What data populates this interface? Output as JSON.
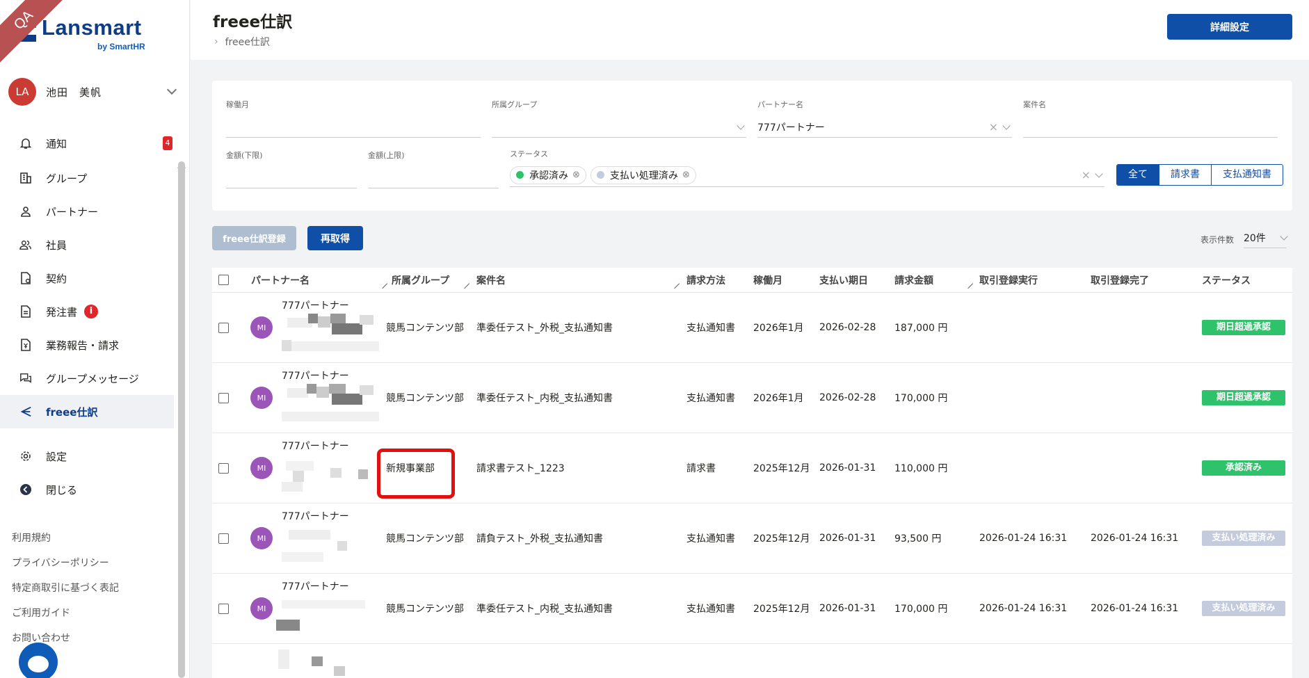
{
  "app": {
    "ribbon": "QA",
    "logo_text": "Lansmart",
    "logo_sub": "by SmartHR"
  },
  "user": {
    "initials": "LA",
    "name": "池田　美帆"
  },
  "nav": {
    "notifications": "通知",
    "notifications_count": "4",
    "group": "グループ",
    "partner": "パートナー",
    "employee": "社員",
    "contract": "契約",
    "order": "発注書",
    "order_badge": "i",
    "report": "業務報告・請求",
    "group_message": "グループメッセージ",
    "freee": "freee仕訳",
    "settings": "設定",
    "close": "閉じる"
  },
  "footer_links": [
    "利用規約",
    "プライバシーポリシー",
    "特定商取引に基づく表記",
    "ご利用ガイド",
    "お問い合わせ"
  ],
  "header": {
    "title": "freee仕訳",
    "breadcrumb": "freee仕訳",
    "detail_button": "詳細設定"
  },
  "filter": {
    "month_label": "稼働月",
    "group_label": "所属グループ",
    "partner_label": "パートナー名",
    "partner_value": "777パートナー",
    "project_label": "案件名",
    "amount_min_label": "金額(下限)",
    "amount_max_label": "金額(上限)",
    "status_label": "ステータス",
    "chips": [
      {
        "label": "承認済み",
        "color": "#2ec36b"
      },
      {
        "label": "支払い処理済み",
        "color": "#c3cbdc"
      }
    ],
    "segments": [
      "全て",
      "請求書",
      "支払通知書"
    ]
  },
  "actions": {
    "register": "freee仕訳登録",
    "refetch": "再取得",
    "page_size_label": "表示件数",
    "page_size_value": "20件"
  },
  "table": {
    "headers": {
      "partner": "パートナー名",
      "group": "所属グループ",
      "project": "案件名",
      "method": "請求方法",
      "month": "稼働月",
      "due": "支払い期日",
      "amount": "請求金額",
      "exec": "取引登録実行",
      "done": "取引登録完了",
      "status": "ステータス"
    },
    "rows": [
      {
        "avatar": "MI",
        "partner": "777パートナー",
        "group": "競馬コンテンツ部",
        "project": "準委任テスト_外税_支払通知書",
        "method": "支払通知書",
        "month": "2026年1月",
        "due": "2026-02-28",
        "amount": "187,000 円",
        "exec": "",
        "done": "",
        "status": "期日超過承認",
        "status_color": "#2ec36b"
      },
      {
        "avatar": "MI",
        "partner": "777パートナー",
        "group": "競馬コンテンツ部",
        "project": "準委任テスト_内税_支払通知書",
        "method": "支払通知書",
        "month": "2026年1月",
        "due": "2026-02-28",
        "amount": "170,000 円",
        "exec": "",
        "done": "",
        "status": "期日超過承認",
        "status_color": "#2ec36b"
      },
      {
        "avatar": "MI",
        "partner": "777パートナー",
        "group": "新規事業部",
        "project": "請求書テスト_1223",
        "method": "請求書",
        "month": "2025年12月",
        "due": "2026-01-31",
        "amount": "110,000 円",
        "exec": "",
        "done": "",
        "status": "承認済み",
        "status_color": "#2ec36b"
      },
      {
        "avatar": "MI",
        "partner": "777パートナー",
        "group": "競馬コンテンツ部",
        "project": "請負テスト_外税_支払通知書",
        "method": "支払通知書",
        "month": "2025年12月",
        "due": "2026-01-31",
        "amount": "93,500 円",
        "exec": "2026-01-24 16:31",
        "done": "2026-01-24 16:31",
        "status": "支払い処理済み",
        "status_color": "#c3cbdc"
      },
      {
        "avatar": "MI",
        "partner": "777パートナー",
        "group": "競馬コンテンツ部",
        "project": "準委任テスト_内税_支払通知書",
        "method": "支払通知書",
        "month": "2025年12月",
        "due": "2026-01-31",
        "amount": "170,000 円",
        "exec": "2026-01-24 16:31",
        "done": "2026-01-24 16:31",
        "status": "支払い処理済み",
        "status_color": "#c3cbdc"
      }
    ]
  }
}
